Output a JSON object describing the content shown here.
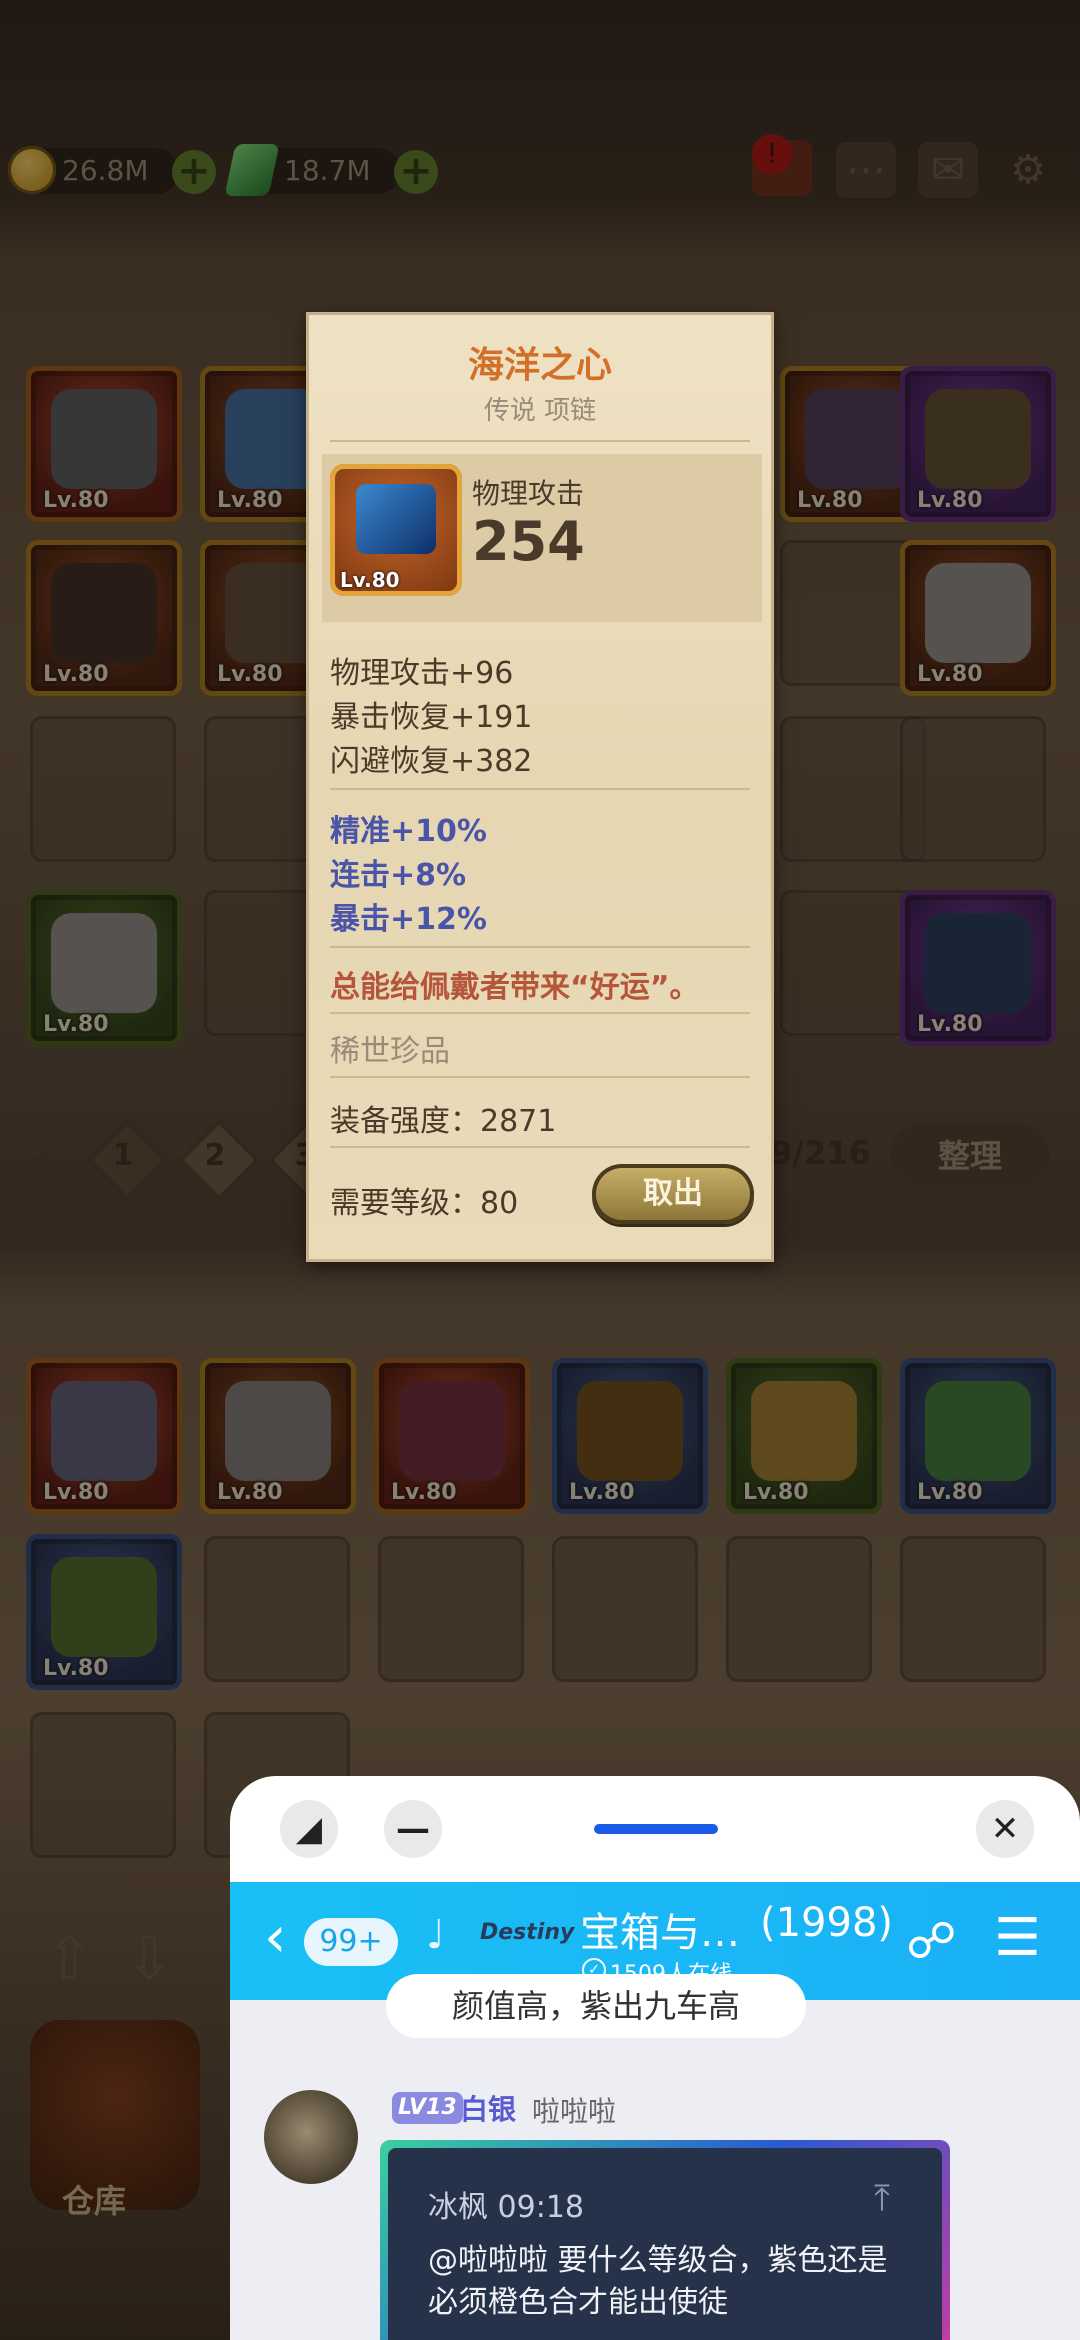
{
  "resources": {
    "gold": "26.8M",
    "gems": "18.7M"
  },
  "tooltip": {
    "name": "海洋之心",
    "subtitle": "传说 项链",
    "item_level": "Lv.80",
    "main_stat_label": "物理攻击",
    "main_stat_value": "254",
    "base_stats": [
      "物理攻击+96",
      "暴击恢复+191",
      "闪避恢复+382"
    ],
    "bonus_stats": [
      "精准+10%",
      "连击+8%",
      "暴击+12%"
    ],
    "flavor": "总能给佩戴者带来“好运”。",
    "rarity_note": "稀世珍品",
    "power_label": "装备强度：2871",
    "required_level_label": "需要等级：80",
    "take_out_label": "取出"
  },
  "inventory": {
    "level_label": "Lv.80",
    "pages": [
      "1",
      "2",
      "3"
    ],
    "count": "9/216",
    "sort_label": "整理"
  },
  "warehouse_label": "仓库",
  "chat": {
    "unread_badge": "99+",
    "group_name": "宝箱与…",
    "member_count": "(1998)",
    "online_text": "1509人在线",
    "logo_text": "Destiny",
    "prev_message": "颜值高，紫出九车高",
    "sender_level": "LV13",
    "sender_rank": "白银",
    "sender_name": "啦啦啦",
    "quoted_author": "冰枫 09:18",
    "message_text": "@啦啦啦 要什么等级合，紫色还是必须橙色合才能出使徒"
  },
  "colors": {
    "chat_bar": "#19c0f5",
    "panel_bg": "#efe2c4",
    "bonus_text": "#4b55a8",
    "flavor_text": "#b5563a"
  }
}
